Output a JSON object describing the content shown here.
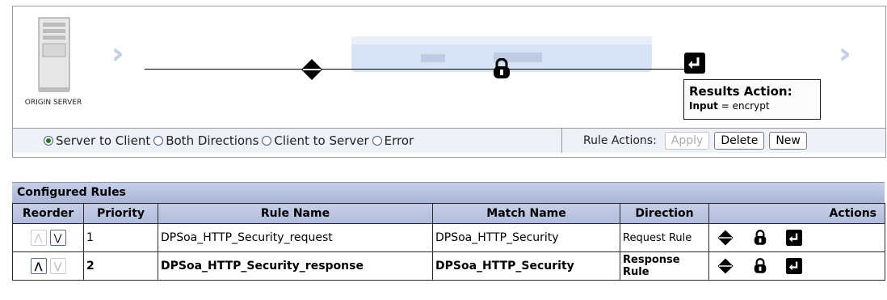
{
  "pipeline": {
    "server_label": "ORIGIN SERVER",
    "tooltip": {
      "title": "Results Action:",
      "key": "Input",
      "equals": "=",
      "value": "encrypt"
    }
  },
  "direction": {
    "options": [
      {
        "label": "Server to Client",
        "selected": true
      },
      {
        "label": "Both Directions",
        "selected": false
      },
      {
        "label": "Client to Server",
        "selected": false
      },
      {
        "label": "Error",
        "selected": false
      }
    ]
  },
  "rule_actions": {
    "label": "Rule Actions:",
    "apply_label": "Apply",
    "delete_label": "Delete",
    "new_label": "New"
  },
  "rules_table": {
    "title": "Configured Rules",
    "headers": [
      "Reorder",
      "Priority",
      "Rule Name",
      "Match Name",
      "Direction",
      "Actions"
    ],
    "rows": [
      {
        "priority": "1",
        "rule_name": "DPSoa_HTTP_Security_request",
        "match_name": "DPSoa_HTTP_Security",
        "direction": "Request Rule",
        "selected": false
      },
      {
        "priority": "2",
        "rule_name": "DPSoa_HTTP_Security_response",
        "match_name": "DPSoa_HTTP_Security",
        "direction": "Response Rule",
        "selected": true
      }
    ]
  },
  "colors": {
    "header_bg": "#b0bbdc",
    "radio_selected": "#1c7a1c"
  }
}
